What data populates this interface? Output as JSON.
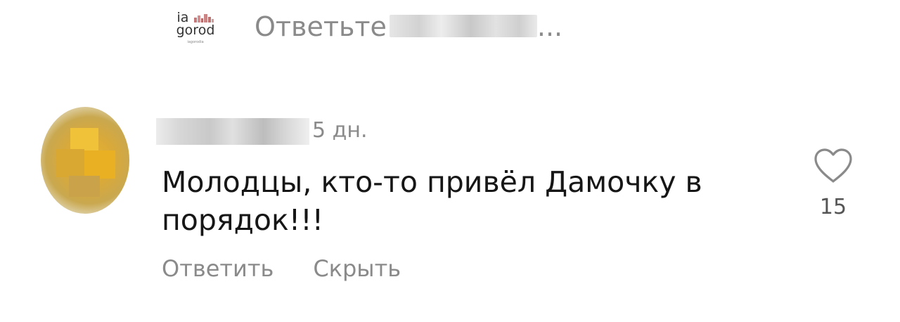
{
  "reply_bar": {
    "logo": {
      "line1": "ia",
      "line2": "gorod",
      "line3": "iagorodia"
    },
    "prompt_text": "Ответьте",
    "ellipsis": "..."
  },
  "comment": {
    "timestamp": "5 дн.",
    "text": "Молодцы, кто-то привёл Дамочку в порядок!!!",
    "like_count": "15",
    "actions": {
      "reply": "Ответить",
      "hide": "Скрыть"
    }
  },
  "colors": {
    "muted": "#8a8a8a",
    "text": "#161616",
    "avatar": "#e9b52c"
  },
  "icons": {
    "like": "heart-outline-icon"
  }
}
